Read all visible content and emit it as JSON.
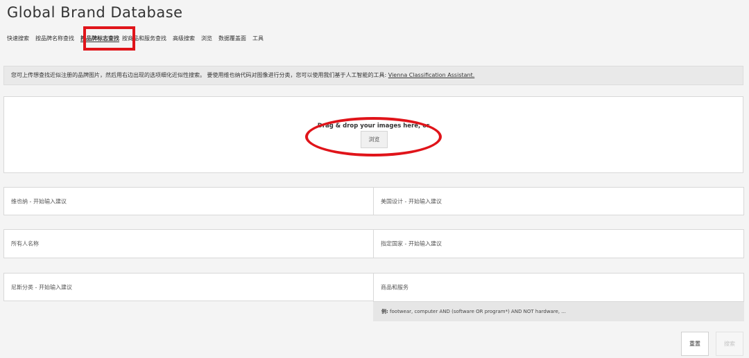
{
  "header": {
    "title": "Global Brand Database"
  },
  "tabs": [
    {
      "label": "快速搜索"
    },
    {
      "label": "按品牌名称查找"
    },
    {
      "label": "按品牌标志查找"
    },
    {
      "label": "按商品和服务查找"
    },
    {
      "label": "高级搜索"
    },
    {
      "label": "浏览"
    },
    {
      "label": "数据覆盖面"
    },
    {
      "label": "工具"
    }
  ],
  "info": {
    "text": "您可上传想查找近似注册的品牌图片，然后用右边出现的选项细化近似性搜索。 要使用维也纳代码对图像进行分类，您可以使用我们基于人工智能的工具: ",
    "link": "Vienna Classification Assistant."
  },
  "dropzone": {
    "text": "Drag & drop your images here, or",
    "browse_label": "浏览"
  },
  "fields": {
    "vienna": "维也纳 - 开始输入建议",
    "us_design": "美国设计 - 开始输入建议",
    "owner": "所有人名称",
    "designated_country": "指定国家 - 开始输入建议",
    "nice": "尼斯分类 - 开始输入建议",
    "goods_services": "商品和服务"
  },
  "hint": {
    "prefix": "例:",
    "text": " footwear, computer AND (software OR program*) AND NOT hardware, ..."
  },
  "buttons": {
    "reset": "重置",
    "search": "搜索"
  },
  "colors": {
    "annotation": "#e0141a",
    "background": "#f4f4f4"
  }
}
